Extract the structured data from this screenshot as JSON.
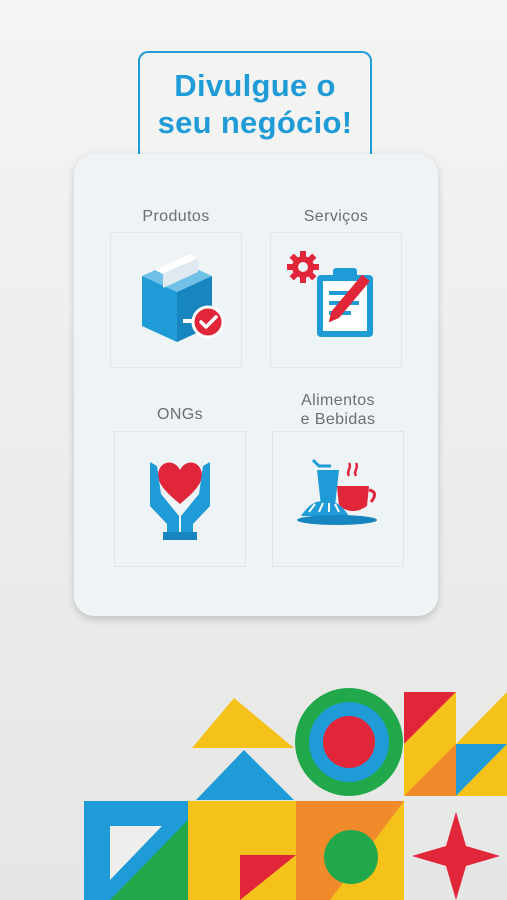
{
  "headline": {
    "line1": "Divulgue o",
    "line2": "seu negócio!"
  },
  "categories": [
    {
      "label": "Produtos",
      "icon": "package-check-icon"
    },
    {
      "label": "Serviços",
      "icon": "clipboard-settings-icon"
    },
    {
      "label": "ONGs",
      "icon": "hands-heart-icon"
    },
    {
      "label_line1": "Alimentos",
      "label_line2": "e Bebidas",
      "icon": "food-drink-icon"
    }
  ],
  "colors": {
    "primary_blue": "#1f9bd7",
    "accent_red": "#e2263a",
    "yellow": "#f4c21a",
    "green": "#21a84a",
    "orange": "#f08a2a"
  }
}
